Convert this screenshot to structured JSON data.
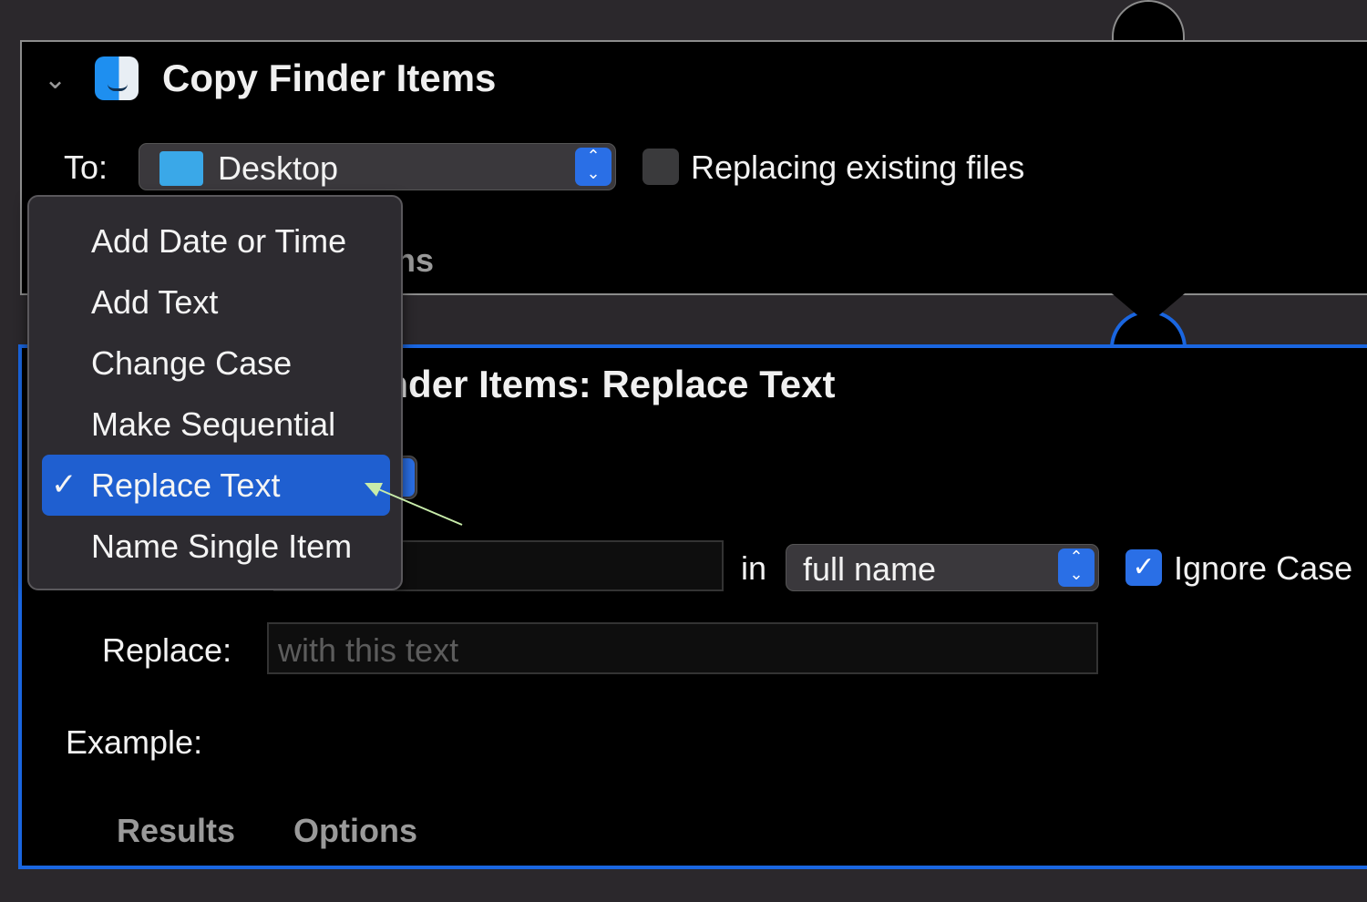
{
  "action1": {
    "title": "Copy Finder Items",
    "to_label": "To:",
    "to_value": "Desktop",
    "replacing_label": "Replacing existing files",
    "replacing_checked": false,
    "hidden_tab_fragment": "Options"
  },
  "action2": {
    "title": "Rename Finder Items: Replace Text",
    "in_label": "in",
    "in_value": "full name",
    "ignore_case_label": "Ignore Case",
    "ignore_case_checked": true,
    "replace_label": "Replace:",
    "replace_placeholder": "with this text",
    "example_label": "Example:",
    "tabs": [
      "Results",
      "Options"
    ]
  },
  "menu": {
    "items": [
      "Add Date or Time",
      "Add Text",
      "Change Case",
      "Make Sequential",
      "Replace Text",
      "Name Single Item"
    ],
    "selected": "Replace Text",
    "check": "✓"
  },
  "colors": {
    "accent": "#1f5fd0",
    "action_border_selected": "#1a66e0",
    "annotation_arrow": "#c8ecaa"
  }
}
